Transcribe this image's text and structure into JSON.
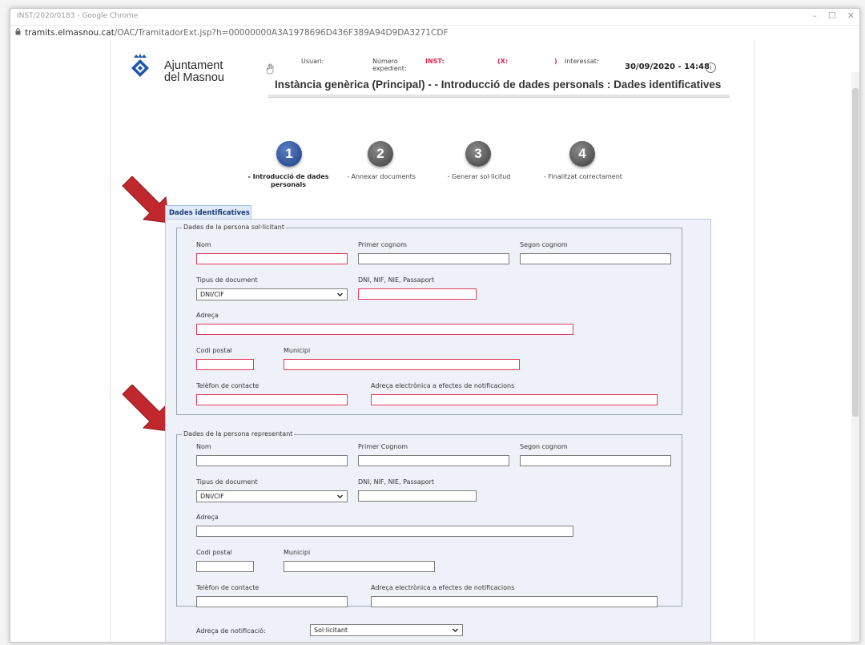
{
  "browser": {
    "window_title": "INST/2020/0183 - Google Chrome",
    "url_host": "tramits.elmasnou.cat",
    "url_path": "/OAC/TramitadorExt.jsp?h=00000000A3A1978696D436F389A94D9DA3271CDF"
  },
  "header": {
    "logo_line1": "Ajuntament",
    "logo_line2": "del Masnou",
    "user_label": "Usuari:",
    "expedient_label_1": "Número",
    "expedient_label_2": "expedient:",
    "expedient_value": "INST:",
    "expedient_code": "(X:",
    "expedient_close": ")",
    "interessat_label": "Interessat:",
    "datetime": "30/09/2020 - 14:48",
    "help": "i",
    "page_title": "Instància genèrica (Principal) - - Introducció de dades personals : Dades identificatives"
  },
  "steps": [
    {
      "number": "1",
      "label_1": "- Introducció de dades",
      "label_2": "personals",
      "active": true
    },
    {
      "number": "2",
      "label_1": "- Annexar documents",
      "label_2": "",
      "active": false
    },
    {
      "number": "3",
      "label_1": "- Generar sol·licitud",
      "label_2": "",
      "active": false
    },
    {
      "number": "4",
      "label_1": "- Finalitzat correctament",
      "label_2": "",
      "active": false
    }
  ],
  "tab": {
    "label": "Dades identificatives"
  },
  "solicitant": {
    "legend": "Dades de la persona sol·licitant",
    "nom": "Nom",
    "primer_cognom": "Primer cognom",
    "segon_cognom": "Segon cognom",
    "tipus_document": "Tipus de document",
    "tipus_document_value": "DNI/CIF",
    "dni_label": "DNI, NIF, NIE, Passaport",
    "adreca": "Adreça",
    "codi_postal": "Codi postal",
    "municipi": "Municipi",
    "telefon": "Telèfon de contacte",
    "email": "Adreça electrònica a efectes de notificacions"
  },
  "representant": {
    "legend": "Dades de la persona representant",
    "nom": "Nom",
    "primer_cognom": "Primer Cognom",
    "segon_cognom": "Segon cognom",
    "tipus_document": "Tipus de document",
    "tipus_document_value": "DNI/CIF",
    "dni_label": "DNI, NIF, NIE, Passaport",
    "adreca": "Adreça",
    "codi_postal": "Codi postal",
    "municipi": "Municipi",
    "telefon": "Telèfon de contacte",
    "email": "Adreça electrònica a efectes de notificacions"
  },
  "notificacio": {
    "label": "Adreça de notificació:",
    "value": "Sol·licitant"
  },
  "colors": {
    "required_border": "#e5395b",
    "step_active": "#1d3f84",
    "step_inactive": "#3e3e3e",
    "arrow": "#c0282d"
  }
}
